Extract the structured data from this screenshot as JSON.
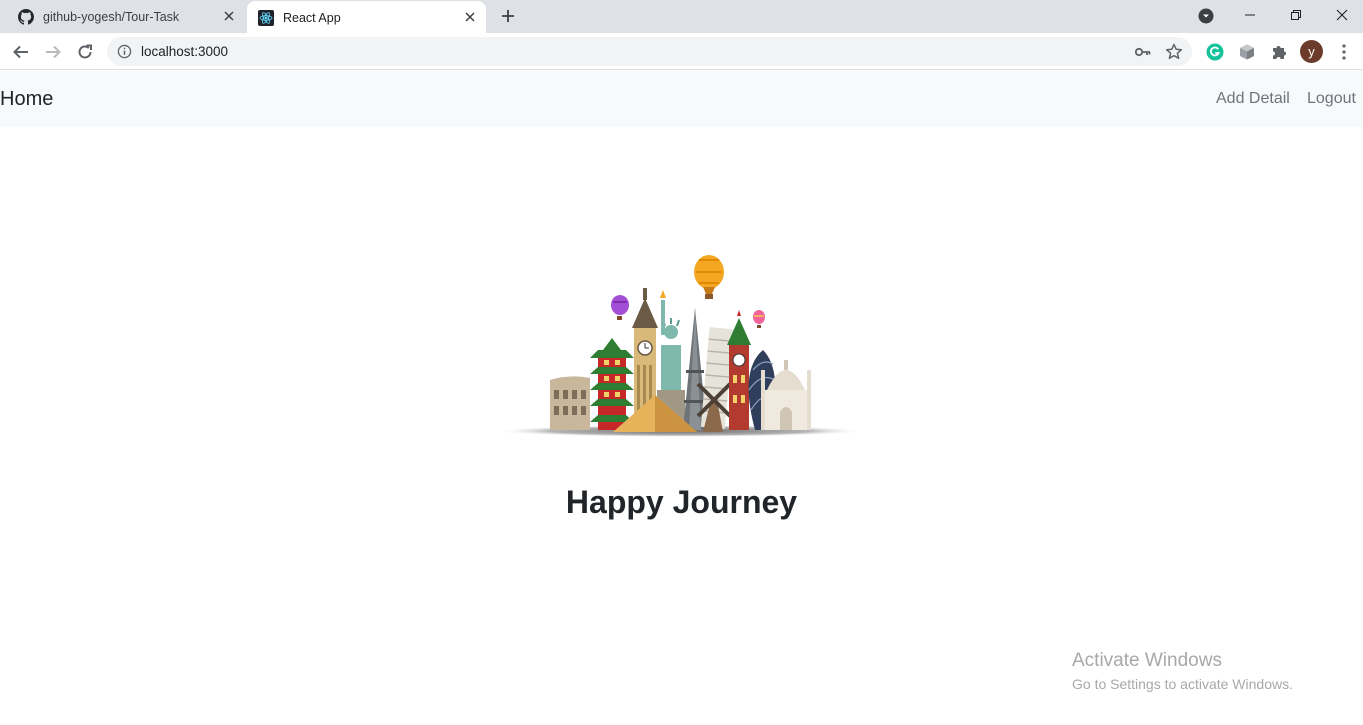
{
  "browser": {
    "tabs": [
      {
        "title": "github-yogesh/Tour-Task",
        "icon": "github-icon",
        "active": false
      },
      {
        "title": "React App",
        "icon": "react-icon",
        "active": true
      }
    ],
    "url": "localhost:3000",
    "profile_initial": "y"
  },
  "navbar": {
    "brand": "Home",
    "links": [
      "Add Detail",
      "Logout"
    ]
  },
  "main": {
    "hero_image": "world-landmarks-illustration",
    "headline": "Happy Journey"
  },
  "os_watermark": {
    "title": "Activate Windows",
    "subtitle": "Go to Settings to activate Windows."
  },
  "colors": {
    "navbar_bg": "#f8f9fa",
    "tabstrip_bg": "#dee1e6",
    "link_muted": "#6c757d",
    "text_dark": "#212529"
  }
}
